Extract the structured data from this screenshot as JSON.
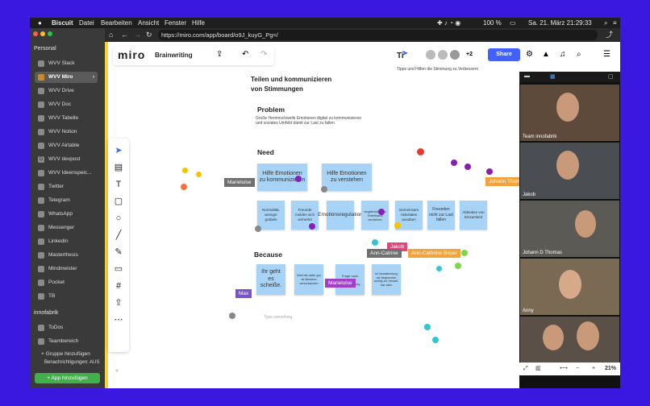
{
  "menubar": {
    "apple": "",
    "app": "Biscuit",
    "menus": [
      "Datei",
      "Bearbeiten",
      "Ansicht",
      "Fenster",
      "Hilfe"
    ],
    "battery": "100 %",
    "datetime": "Sa. 21. März  21:29:33"
  },
  "sidebar": {
    "section_personal": "Personal",
    "items": [
      {
        "label": "WVV Slack",
        "icon": "slack-icon"
      },
      {
        "label": "WVV Miro",
        "icon": "miro-icon"
      },
      {
        "label": "WVV Drive",
        "icon": "drive-icon"
      },
      {
        "label": "WVV Doc",
        "icon": "doc-icon"
      },
      {
        "label": "WVV Tabelle",
        "icon": "sheet-icon"
      },
      {
        "label": "WVV Notion",
        "icon": "notion-icon"
      },
      {
        "label": "WVV Airtable",
        "icon": "airtable-icon"
      },
      {
        "label": "WVV devpost",
        "icon": "devpost-icon"
      },
      {
        "label": "WVV Ideenspeic...",
        "icon": "sheet-icon"
      },
      {
        "label": "Twitter",
        "icon": "twitter-icon"
      },
      {
        "label": "Telegram",
        "icon": "telegram-icon"
      },
      {
        "label": "WhatsApp",
        "icon": "whatsapp-icon"
      },
      {
        "label": "Messenger",
        "icon": "messenger-icon"
      },
      {
        "label": "LinkedIn",
        "icon": "linkedin-icon"
      },
      {
        "label": "Masterthesis",
        "icon": "doc-icon"
      },
      {
        "label": "Mindmeister",
        "icon": "mindmeister-icon"
      },
      {
        "label": "Pocket",
        "icon": "pocket-icon"
      },
      {
        "label": "TB",
        "icon": "tb-icon"
      }
    ],
    "section_innofabrik": "innofabrik",
    "inno_items": [
      {
        "label": "ToDos",
        "icon": "todo-icon"
      },
      {
        "label": "Teambereich",
        "icon": "team-icon"
      }
    ],
    "add_group": "+ Gruppe hinzufügen",
    "notifications": "Benachrichtigungen: AUS",
    "add_app": "+ App hinzufügen"
  },
  "browser": {
    "url": "https://miro.com/app/board/o9J_kuyG_Pg=/"
  },
  "miro": {
    "logo": "miro",
    "board_name": "Brainwriting",
    "share": "Share",
    "participants_extra": "+2",
    "tips_title": "Ti",
    "tips_text": "Tipps und Hilfen die Stimmung zu Verbessern",
    "heading": "Teilen und kommunizieren\nvon Stimmungen",
    "problem_title": "Problem",
    "problem_text": "Große Hemmschwelle Emotionen digital zu kommunizieren\nund soziales Umfeld damit zur Last zu fallen",
    "need_title": "Need",
    "because_title": "Because",
    "type_something": "Type something",
    "zoom": "21%"
  },
  "notes_need_big": [
    "Hilfe Emotionen zu kommunizieren",
    "Hilfe Emotionen zu verstehen"
  ],
  "notes_need_small": [
    "Normalität, weniger grübeln",
    "Freunde melden sich vermehrt",
    "Emotionsregulation",
    "negativistige zu Teilefinanz verstehen",
    "Gemeinsam Aktivitäten ausüben",
    "Freunden nicht zur Last fallen",
    "Ablenken von Einsamkeit"
  ],
  "notes_because": [
    "Ihr geht es scheiße.",
    "Weil die dafür gut ist Bestand verschwinden",
    "Frage nach soziale Unterstützung",
    "Ist Verwaltendung als Wegbereiter wichtig zur Verwalt-Ivar dann"
  ],
  "cursor_tags": [
    {
      "label": "Marielulse",
      "color": "#707070"
    },
    {
      "label": "Johann Thomas",
      "color": "#f2a33a"
    },
    {
      "label": "Jakob",
      "color": "#e0457b"
    },
    {
      "label": "Ann-Catrine",
      "color": "#707070"
    },
    {
      "label": "Ann-Cathrine Beyer",
      "color": "#f2a33a"
    },
    {
      "label": "Marielulse",
      "color": "#a23ec9"
    },
    {
      "label": "Max",
      "color": "#7a54c7"
    }
  ],
  "video": {
    "participants": [
      "Team innofabrik",
      "Jakob",
      "Johann D Thomas",
      "Anny",
      ""
    ]
  },
  "colors": {
    "accent": "#4262ff",
    "sticky": "#a7d3f7",
    "desktop": "#3a18e0"
  }
}
